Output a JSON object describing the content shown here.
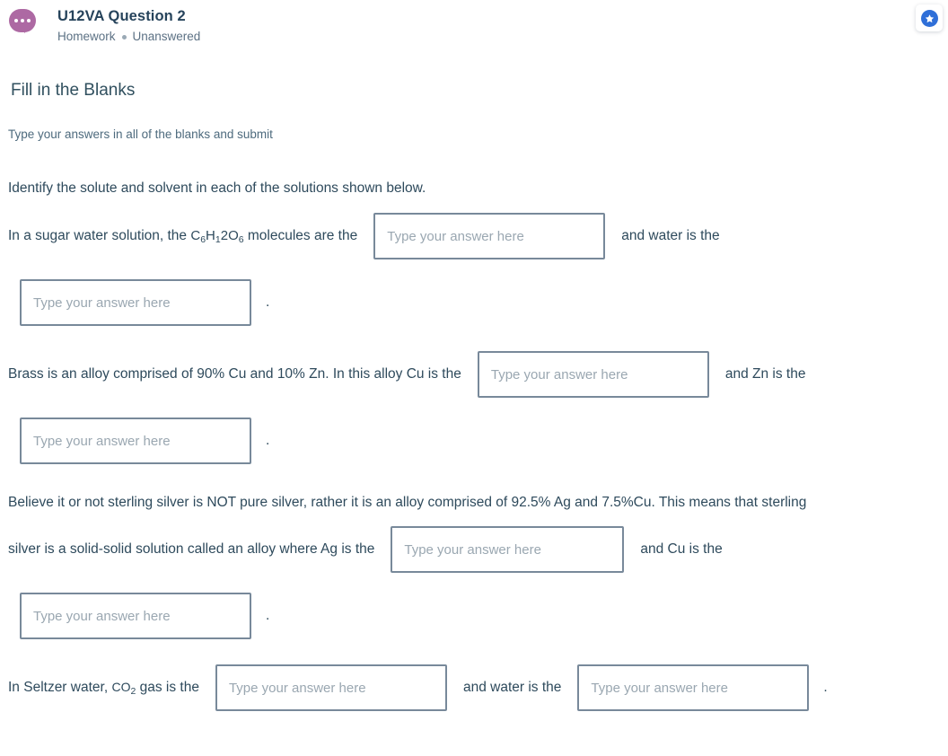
{
  "header": {
    "avatar_icon": "chat-bubble-ellipsis-icon",
    "title": "U12VA Question 2",
    "category": "Homework",
    "status": "Unanswered",
    "badge_icon": "star-badge-icon",
    "badge_color": "#2f6fd8",
    "avatar_color": "#ad69a3"
  },
  "section": {
    "title": "Fill in the Blanks",
    "instructions": "Type your answers in all of the blanks and submit"
  },
  "question": {
    "prompt": "Identify the solute and solvent in each of the solutions shown below.",
    "placeholder": "Type your answer here",
    "items": [
      {
        "lead_text": "In a sugar water solution, the ",
        "formula": "C6H12O6",
        "formula_parts": [
          {
            "t": "C",
            "sub": false
          },
          {
            "t": "6",
            "sub": true
          },
          {
            "t": "H",
            "sub": false
          },
          {
            "t": "1",
            "sub": true
          },
          {
            "t": "2",
            "sub": false
          },
          {
            "t": "O",
            "sub": false
          },
          {
            "t": "6",
            "sub": true
          }
        ],
        "after_formula_text": " molecules are the",
        "blank1_value": "",
        "mid_text": "and water is the",
        "blank2_value": "",
        "end_text": "."
      },
      {
        "lead_text": "Brass is an alloy comprised of 90% Cu and 10% Zn. In this alloy Cu is the",
        "blank1_value": "",
        "mid_text": "and Zn is the",
        "blank2_value": "",
        "end_text": "."
      },
      {
        "lead_text": "Believe it or not sterling silver is NOT pure silver, rather it is an alloy comprised of 92.5% Ag and 7.5%Cu. This means that sterling",
        "lead_text_line2": "silver is a solid-solid solution called an alloy where Ag is the",
        "blank1_value": "",
        "mid_text": "and Cu is the",
        "blank2_value": "",
        "end_text": "."
      },
      {
        "lead_text": "In Seltzer water, ",
        "formula_parts": [
          {
            "t": "C",
            "sub": false,
            "caps": true
          },
          {
            "t": "O",
            "sub": false,
            "caps": true
          },
          {
            "t": "2",
            "sub": true
          }
        ],
        "after_formula_text": " gas is the",
        "blank1_value": "",
        "mid_text": "and water is the",
        "blank2_value": "",
        "end_text": "."
      }
    ]
  }
}
